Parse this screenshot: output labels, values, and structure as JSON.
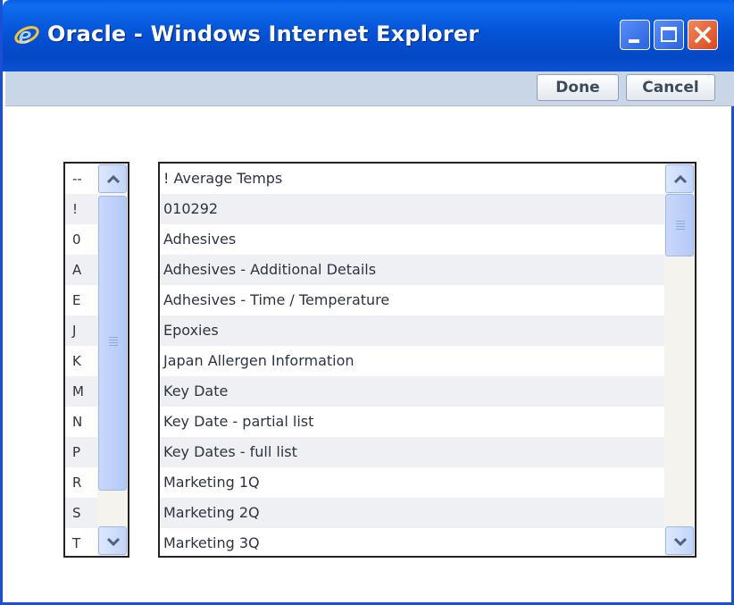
{
  "window": {
    "title": "Oracle - Windows Internet Explorer"
  },
  "toolbar": {
    "done_label": "Done",
    "cancel_label": "Cancel"
  },
  "letter_index": [
    "--",
    "!",
    "0",
    "A",
    "E",
    "J",
    "K",
    "M",
    "N",
    "P",
    "R",
    "S",
    "T"
  ],
  "items": [
    "! Average Temps",
    "010292",
    "Adhesives",
    "Adhesives - Additional Details",
    "Adhesives - Time / Temperature",
    "Epoxies",
    "Japan Allergen Information",
    "Key Date",
    "Key Date - partial list",
    "Key Dates - full list",
    "Marketing 1Q",
    "Marketing 2Q",
    "Marketing 3Q"
  ],
  "colors": {
    "titlebar": "#0553d6",
    "toolbar": "#c9d6e8",
    "alt_row": "#eef0f3",
    "close_button": "#d9461c"
  },
  "icons": {
    "app": "ie-logo-icon",
    "minimize": "minimize-icon",
    "maximize": "maximize-icon",
    "close": "close-icon"
  }
}
